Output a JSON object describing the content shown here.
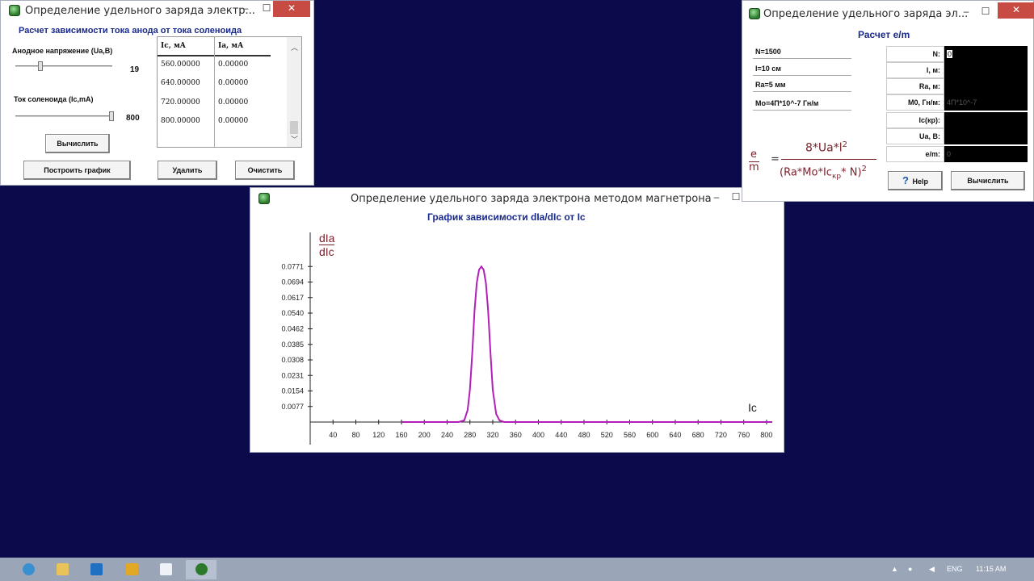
{
  "win1": {
    "title": "Определение удельного заряда электр...",
    "min": "–",
    "max": "☐",
    "close": "✕",
    "subtitle": "Расчет зависимости тока анода от тока соленоида",
    "anode_label": "Анодное напряжение (Ua,B)",
    "anode_value": "19",
    "solenoid_label": "Ток соленоида (Ic,mA)",
    "solenoid_value": "800",
    "calc_button": "Вычислить",
    "table": {
      "headers": [
        "Ic, мA",
        "Ia, мA"
      ],
      "rows": [
        [
          "560.00000",
          "0.00000"
        ],
        [
          "640.00000",
          "0.00000"
        ],
        [
          "720.00000",
          "0.00000"
        ],
        [
          "800.00000",
          "0.00000"
        ]
      ]
    },
    "buttons": [
      "Построить график",
      "Удалить",
      "Очистить"
    ]
  },
  "win2": {
    "title": "Определение удельного заряда электрона методом магнетрона",
    "min": "–",
    "max": "☐",
    "chart_title": "График зависимости  dIa/dIc от Ic"
  },
  "win3": {
    "title": "Определение удельного заряда эл...",
    "min": "–",
    "max": "☐",
    "close": "✕",
    "subtitle": "Расчет e/m",
    "info": [
      "N=1500",
      "l=10 см",
      "Ra=5 мм",
      "Mo=4П*10^-7 Гн/м"
    ],
    "fields": [
      {
        "label": "N:",
        "value": "0"
      },
      {
        "label": "l, м:",
        "value": ""
      },
      {
        "label": "Ra, м:",
        "value": ""
      },
      {
        "label": "M0, Гн/м:",
        "value": "4П*10^-7"
      },
      {
        "label": "Ic(кр):",
        "value": ""
      },
      {
        "label": "Ua, B:",
        "value": ""
      },
      {
        "label": "e/m:",
        "value": "0"
      }
    ],
    "formula": {
      "lhs_num": "e",
      "lhs_den": "m",
      "eq": "=",
      "numerator": "8*Ua*l",
      "num_exp": "2",
      "denominator": "(Ra*Mo*Ic",
      "den_sub": "кр",
      "den_tail": "* N)",
      "den_exp": "2"
    },
    "help_button": "Help",
    "help_icon": "?",
    "calc_button": "Вычислить"
  },
  "taskbar": {
    "lang": "ENG",
    "time": "11:15 AM"
  },
  "chart_data": {
    "type": "line",
    "title": "График зависимости  dIa/dIc от Ic",
    "ylabel_num": "dIa",
    "ylabel_den": "dIc",
    "xlabel": "Ic",
    "x_ticks": [
      40,
      80,
      120,
      160,
      200,
      240,
      280,
      320,
      360,
      400,
      440,
      480,
      520,
      560,
      600,
      640,
      680,
      720,
      760,
      800
    ],
    "y_ticks": [
      0.0077,
      0.0154,
      0.0231,
      0.0308,
      0.0385,
      0.0462,
      0.054,
      0.0617,
      0.0694,
      0.0771
    ],
    "y_tick_labels": [
      "0.0077",
      "0.0154",
      "0.0231",
      "0.0308",
      "0.0385",
      "0.0462",
      "0.0540",
      "0.0617",
      "0.0694",
      "0.0771"
    ],
    "xlim": [
      0,
      810
    ],
    "ylim": [
      0,
      0.08
    ],
    "color": "#b21fb8",
    "series": [
      {
        "x": [
          160,
          200,
          240,
          260,
          270,
          276,
          280,
          284,
          288,
          292,
          296,
          300,
          304,
          308,
          312,
          316,
          320,
          326,
          332,
          340,
          360,
          400,
          480,
          560,
          640,
          720,
          800,
          810
        ],
        "y": [
          0,
          0,
          0,
          0,
          0.0008,
          0.006,
          0.016,
          0.034,
          0.055,
          0.069,
          0.0755,
          0.0771,
          0.0755,
          0.069,
          0.055,
          0.034,
          0.016,
          0.004,
          0.0008,
          0,
          0,
          0,
          0,
          0,
          0,
          0,
          0,
          0
        ]
      }
    ]
  }
}
